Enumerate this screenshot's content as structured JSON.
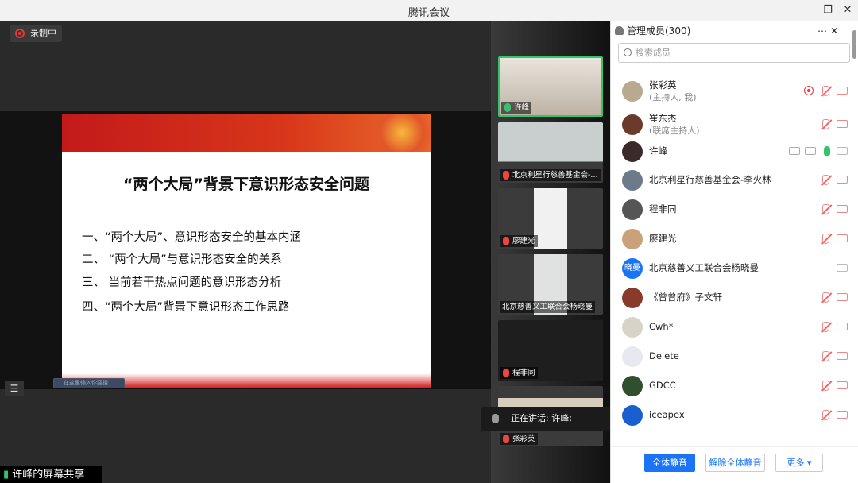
{
  "window": {
    "title": "腾讯会议"
  },
  "recording": {
    "label": "录制中"
  },
  "slide": {
    "title": "“两个大局”背景下意识形态安全问题",
    "items": [
      "一、“两个大局”、意识形态安全的基本内涵",
      "二、 “两个大局”与意识形态安全的关系",
      "三、  当前若干热点问题的意识形态分析",
      "四、“两个大局”背景下意识形态工作思路"
    ],
    "mini_search": "在这里输入你要搜"
  },
  "screen_share": {
    "label": "许峰的屏幕共享"
  },
  "video_tiles": [
    {
      "name": "许峰",
      "active": true
    },
    {
      "name": "北京利星行慈善基金会-..."
    },
    {
      "name": "廖建光"
    },
    {
      "name": "北京慈善义工联合会杨晓曼"
    },
    {
      "name": "程非同"
    },
    {
      "name": "张彩英"
    }
  ],
  "speaking": {
    "text": "正在讲话: 许峰;"
  },
  "panel": {
    "title": "管理成员(300)",
    "search_placeholder": "搜索成员",
    "members": [
      {
        "name": "张彩英",
        "sub": "(主持人, 我)",
        "avatar_color": "#b9a98e"
      },
      {
        "name": "崔东杰",
        "sub": "(联席主持人)",
        "avatar_color": "#6a3a2a"
      },
      {
        "name": "许峰",
        "avatar_color": "#3a2a2a"
      },
      {
        "name": "北京利星行慈善基金会-李火林",
        "avatar_color": "#6d7a8a"
      },
      {
        "name": "程非同",
        "avatar_color": "#555555"
      },
      {
        "name": "廖建光",
        "avatar_color": "#c9a27c"
      },
      {
        "name": "北京慈善义工联合会杨晓曼",
        "avatar_color": "#1a74f5",
        "avatar_text": "晓曼"
      },
      {
        "name": "《曾曾府》子文轩",
        "avatar_color": "#8a3a2a"
      },
      {
        "name": "Cwh*",
        "avatar_color": "#d9d2c8"
      },
      {
        "name": "Delete",
        "avatar_color": "#e8e8f0"
      },
      {
        "name": "GDCC",
        "avatar_color": "#2f4f2f"
      },
      {
        "name": "iceapex",
        "avatar_color": "#1a5fd0"
      }
    ],
    "buttons": {
      "mute_all": "全体静音",
      "unmute_all": "解除全体静音",
      "more": "更多 ▾"
    }
  }
}
